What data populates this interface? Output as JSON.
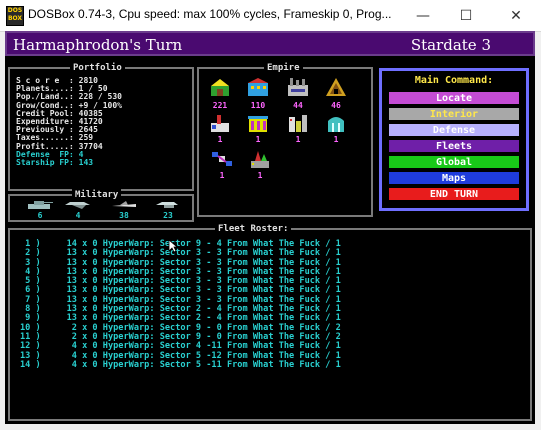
{
  "window": {
    "icon_text": "DOS BOX",
    "title": "DOSBox 0.74-3, Cpu speed: max 100% cycles, Frameskip  0, Prog...",
    "minimize": "—",
    "maximize": "☐",
    "close": "✕"
  },
  "header": {
    "turn": "Harmaphrodon's Turn",
    "stardate": "Stardate 3"
  },
  "portfolio": {
    "title": "Portfolio",
    "rows": [
      {
        "label": "S c o r e  : ",
        "value": "2810",
        "cyan": false
      },
      {
        "label": "Planets....: ",
        "value": "1 / 50",
        "cyan": false
      },
      {
        "label": "Pop./Land..: ",
        "value": "228 / 530",
        "cyan": false
      },
      {
        "label": "Grow/Cond..: ",
        "value": "+9 / 100%",
        "cyan": false
      },
      {
        "label": "Credit Pool: ",
        "value": "40385",
        "cyan": false
      },
      {
        "label": "Expenditure: ",
        "value": "41720",
        "cyan": false
      },
      {
        "label": "Previously : ",
        "value": "2645",
        "cyan": false
      },
      {
        "label": "Taxes......: ",
        "value": "259",
        "cyan": false
      },
      {
        "label": "Profit.....: ",
        "value": "37704",
        "cyan": false
      },
      {
        "label": "Defense  FP: ",
        "value": "4",
        "cyan": true
      },
      {
        "label": "Starship FP: ",
        "value": "143",
        "cyan": true
      }
    ]
  },
  "empire": {
    "title": "Empire",
    "counts": [
      "221",
      "110",
      "44",
      "46",
      "1",
      "1",
      "1",
      "1",
      "1",
      "1"
    ]
  },
  "military": {
    "title": "Military",
    "counts": [
      "6",
      "4",
      "38",
      "23"
    ]
  },
  "main_command": {
    "title": "Main Command:",
    "items": [
      "Locate",
      "Interior",
      "Defense",
      "Fleets",
      "Global",
      "Maps",
      "END   TURN"
    ],
    "colors": [
      "#c44cd4",
      "#a8a8a8",
      "#b6b0ff",
      "#6f1fa8",
      "#18c818",
      "#1f3cdc",
      "#e81c1c"
    ],
    "text_colors": [
      "#ffffff",
      "#ffe84a",
      "#ffffff",
      "#ffffff",
      "#ffffff",
      "#ffffff",
      "#ffffff"
    ]
  },
  "roster": {
    "title": "Fleet Roster:",
    "rows": [
      " 1 )     14 x 0 HyperWarp: Sector 9 - 4 From What The Fuck / 1",
      " 2 )     13 x 0 HyperWarp: Sector 3 - 3 From What The Fuck / 1",
      " 3 )     13 x 0 HyperWarp: Sector 3 - 3 From What The Fuck / 1",
      " 4 )     13 x 0 HyperWarp: Sector 3 - 3 From What The Fuck / 1",
      " 5 )     13 x 0 HyperWarp: Sector 3 - 3 From What The Fuck / 1",
      " 6 )     13 x 0 HyperWarp: Sector 3 - 3 From What The Fuck / 1",
      " 7 )     13 x 0 HyperWarp: Sector 3 - 3 From What The Fuck / 1",
      " 8 )     13 x 0 HyperWarp: Sector 2 - 4 From What The Fuck / 1",
      " 9 )     13 x 0 HyperWarp: Sector 2 - 4 From What The Fuck / 1",
      "10 )      2 x 0 HyperWarp: Sector 9 - 0 From What The Fuck / 2",
      "11 )      2 x 0 HyperWarp: Sector 9 - 0 From What The Fuck / 2",
      "12 )      4 x 0 HyperWarp: Sector 4 -11 From What The Fuck / 1",
      "13 )      4 x 0 HyperWarp: Sector 5 -12 From What The Fuck / 1",
      "14 )      4 x 0 HyperWarp: Sector 5 -11 From What The Fuck / 1"
    ]
  }
}
